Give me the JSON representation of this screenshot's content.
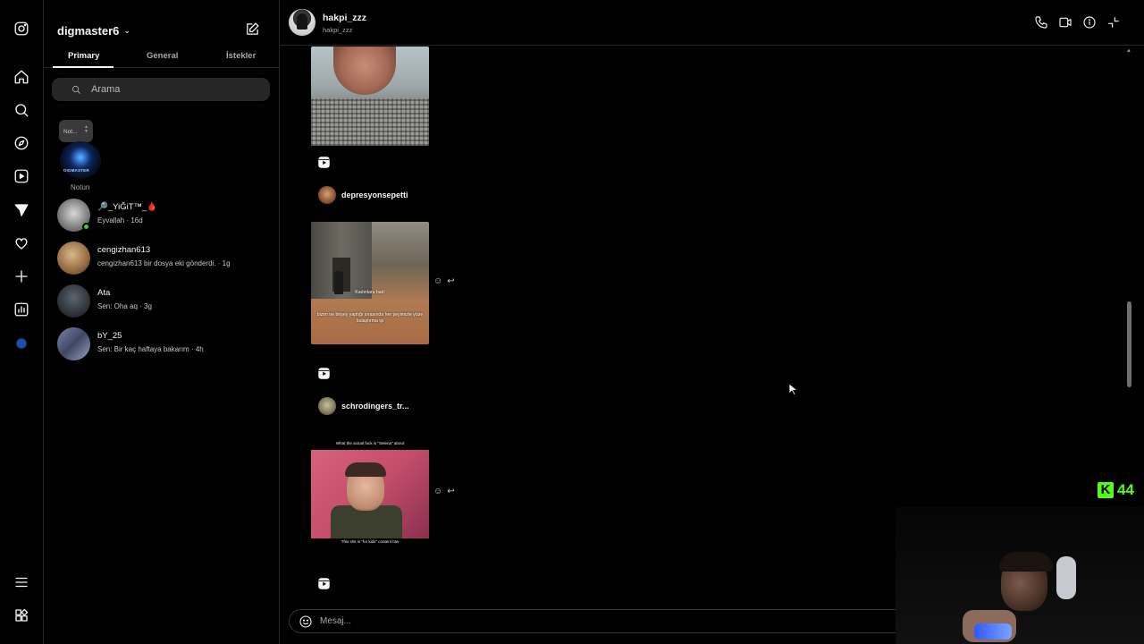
{
  "rail": {
    "icons": [
      "instagram-icon",
      "home-icon",
      "search-icon",
      "explore-icon",
      "reels-icon",
      "messages-icon",
      "notifications-icon",
      "create-icon",
      "dashboard-icon",
      "profile-icon",
      "menu-icon",
      "meta-apps-icon"
    ]
  },
  "inbox": {
    "account_name": "digmaster6",
    "tabs": [
      "Primary",
      "General",
      "İstekler"
    ],
    "search_placeholder": "Arama",
    "note": {
      "bubble_text": "Not...",
      "avatar_text": "DIGMASTER",
      "label": "Notun"
    },
    "threads": [
      {
        "name": "🔎_YiĞiT™_🩸",
        "preview": "Eyvallah · 16d",
        "online": true
      },
      {
        "name": "cengizhan613",
        "preview": "cengizhan613 bir dosya eki gönderdi. · 1g",
        "online": false
      },
      {
        "name": "Ata",
        "preview": "Sen: Oha aq · 3g",
        "online": false
      },
      {
        "name": "bY_25",
        "preview": "Sen: Bir kaç haftaya bakarım · 4h",
        "online": false
      }
    ]
  },
  "chat": {
    "contact_name": "hakpi_zzz",
    "contact_username": "hakpi_zzz",
    "header_actions": [
      "phone-icon",
      "video-call-icon",
      "info-icon",
      "minimize-icon"
    ],
    "messages": [
      {
        "type": "reel",
        "sender": "depresyonsepetti"
      },
      {
        "type": "reel",
        "sender": "schrodingers_tr...",
        "caption_top": "Kadınlara bak!",
        "caption_bottom": "bizim ne birşey yaptığı sırasında her şeyimizle yüze bulaştırma işi"
      },
      {
        "type": "reel",
        "caption_top": "What the actual fuck is \"Selena\" about",
        "caption_bottom": "This shit is \"for kids\" content btw"
      }
    ],
    "composer_placeholder": "Mesaj..."
  },
  "overlay": {
    "kick_letter": "K",
    "viewer_count": "44"
  },
  "colors": {
    "background": "#000000",
    "text": "#f5f5f5",
    "muted": "#a8a8a8",
    "divider": "#262626",
    "kick_green": "#53fc18",
    "online_green": "#3ec84a"
  }
}
